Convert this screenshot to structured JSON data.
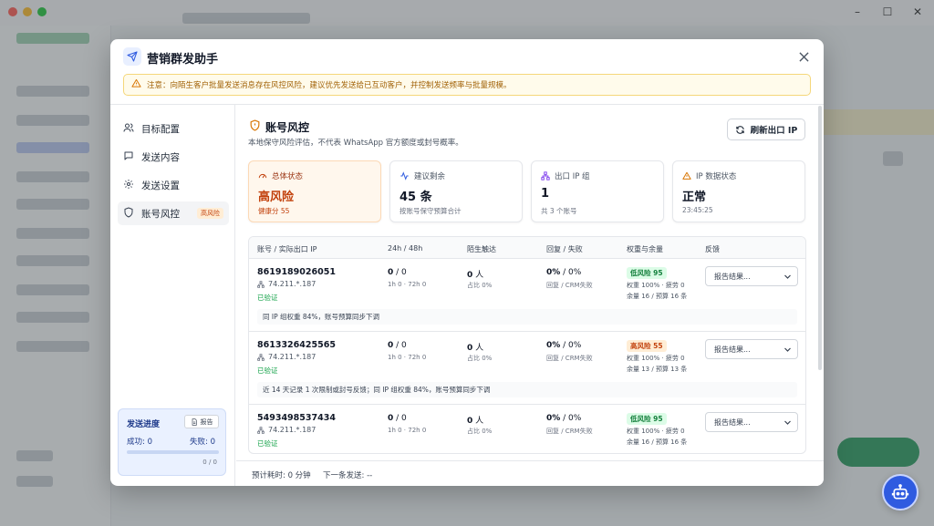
{
  "modal": {
    "title": "营销群发助手",
    "warning": "注意：向陌生客户批量发送消息存在风控风险，建议优先发送给已互动客户，并控制发送频率与批量规模。"
  },
  "nav": {
    "items": [
      {
        "label": "目标配置",
        "icon": "users-icon"
      },
      {
        "label": "发送内容",
        "icon": "message-icon"
      },
      {
        "label": "发送设置",
        "icon": "gear-icon"
      },
      {
        "label": "账号风控",
        "icon": "shield-icon",
        "badge": "高风险"
      }
    ],
    "progress": {
      "title": "发送进度",
      "report_label": "报告",
      "success_label": "成功: 0",
      "fail_label": "失败: 0",
      "count": "0 / 0",
      "fraction": 0
    }
  },
  "section": {
    "title": "账号风控",
    "subtitle": "本地保守风险评估，不代表 WhatsApp 官方额度或封号概率。",
    "refresh_label": "刷新出口 IP"
  },
  "stats": [
    {
      "label": "总体状态",
      "value": "高风险",
      "sub": "健康分 55",
      "icon": "gauge-icon"
    },
    {
      "label": "建议剩余",
      "value": "45 条",
      "sub": "按账号保守预算合计",
      "icon": "activity-icon"
    },
    {
      "label": "出口 IP 组",
      "value": "1",
      "sub": "共 3 个账号",
      "icon": "network-icon"
    },
    {
      "label": "IP 数据状态",
      "value": "正常",
      "sub": "23:45:25",
      "icon": "warning-icon"
    }
  ],
  "table": {
    "headers": [
      "账号 / 实际出口 IP",
      "24h / 48h",
      "陌生触达",
      "回复 / 失败",
      "权重与余量",
      "反馈"
    ],
    "rows": [
      {
        "phone": "8619189026051",
        "ip": "74.211.*.187",
        "verified": "已验证",
        "h24": "0",
        "h48": "/ 0",
        "h_sub": "1h 0 · 72h 0",
        "stranger": "0",
        "stranger_unit": "人",
        "stranger_sub": "占比 0%",
        "reply": "0%",
        "fail": "/ 0%",
        "reply_sub": "回复 / CRM失败",
        "risk": "低风险 95",
        "risk_level": "low",
        "weight": "权重 100% · 疲劳 0",
        "quota": "余量 16 / 预算 16 条",
        "feedback": "报告结果...",
        "note": "同 IP 组权重 84%，账号预算同步下调"
      },
      {
        "phone": "8613326425565",
        "ip": "74.211.*.187",
        "verified": "已验证",
        "h24": "0",
        "h48": "/ 0",
        "h_sub": "1h 0 · 72h 0",
        "stranger": "0",
        "stranger_unit": "人",
        "stranger_sub": "占比 0%",
        "reply": "0%",
        "fail": "/ 0%",
        "reply_sub": "回复 / CRM失败",
        "risk": "高风险 55",
        "risk_level": "high",
        "weight": "权重 100% · 疲劳 0",
        "quota": "余量 13 / 预算 13 条",
        "feedback": "报告结果...",
        "note": "近 14 天记录 1 次限制或封号反馈；同 IP 组权重 84%，账号预算同步下调"
      },
      {
        "phone": "5493498537434",
        "ip": "74.211.*.187",
        "verified": "已验证",
        "h24": "0",
        "h48": "/ 0",
        "h_sub": "1h 0 · 72h 0",
        "stranger": "0",
        "stranger_unit": "人",
        "stranger_sub": "占比 0%",
        "reply": "0%",
        "fail": "/ 0%",
        "reply_sub": "回复 / CRM失败",
        "risk": "低风险 95",
        "risk_level": "low",
        "weight": "权重 100% · 疲劳 0",
        "quota": "余量 16 / 预算 16 条",
        "feedback": "报告结果..."
      }
    ]
  },
  "footer": {
    "eta": "预计耗时: 0 分钟",
    "next": "下一条发送: --"
  },
  "colors": {
    "accent": "#2f5be0",
    "risk_high": "#c2410c",
    "risk_low": "#15803d",
    "verified": "#16a34a"
  }
}
